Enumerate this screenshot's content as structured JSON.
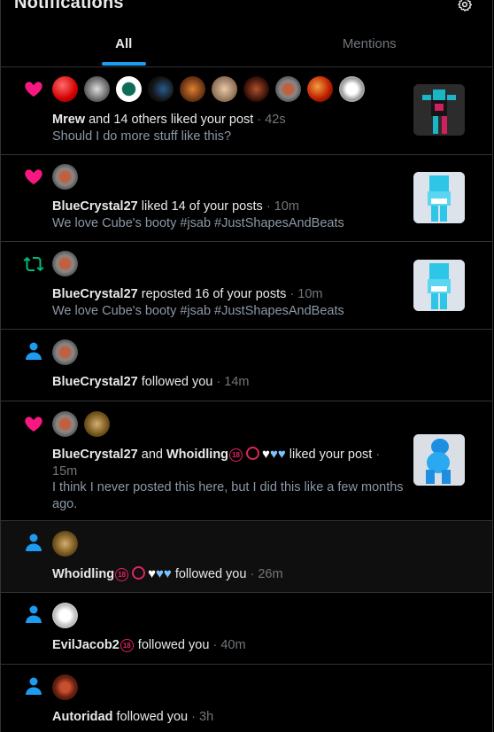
{
  "header": {
    "title": "Notifications",
    "tabs": [
      {
        "label": "All"
      },
      {
        "label": "Mentions"
      }
    ]
  },
  "notifications": [
    {
      "type": "like",
      "actor": "Mrew",
      "text": "and 14 others liked your post",
      "time": "42s",
      "snippet": "Should I do more stuff like this?"
    },
    {
      "type": "like",
      "actor": "BlueCrystal27",
      "text": "liked 14 of your posts",
      "time": "10m",
      "snippet": "We love Cube's booty #jsab #JustShapesAndBeats"
    },
    {
      "type": "repost",
      "actor": "BlueCrystal27",
      "text": "reposted 16 of your posts",
      "time": "10m",
      "snippet": "We love Cube's booty #jsab #JustShapesAndBeats"
    },
    {
      "type": "follow",
      "actor": "BlueCrystal27",
      "text": "followed you",
      "time": "14m"
    },
    {
      "type": "like",
      "actor": "BlueCrystal27",
      "joiner": "and",
      "actor2": "Whoidling",
      "text": "liked your post",
      "time": "15m",
      "snippet": "I think I never posted this here, but I did this like a few months ago."
    },
    {
      "type": "follow",
      "actor": "Whoidling",
      "text": "followed you",
      "time": "26m"
    },
    {
      "type": "follow",
      "actor": "EvilJacob2",
      "text": "followed you",
      "time": "40m"
    },
    {
      "type": "follow",
      "actor": "Autoridad",
      "text": "followed you",
      "time": "3h"
    }
  ],
  "emoji": {
    "eighteen": "18",
    "white_heart": "♥",
    "blue_heart": "♥",
    "dot": "·"
  },
  "colors": {
    "like": "#f91880",
    "repost": "#00ba7c",
    "follow": "#1d9bf0",
    "accent": "#1d9bf0",
    "muted": "#71767b",
    "border": "#2f3336"
  }
}
